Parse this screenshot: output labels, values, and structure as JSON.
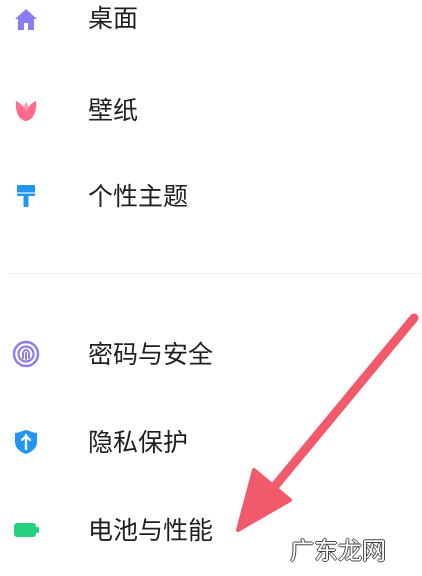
{
  "settings": {
    "items": [
      {
        "label": "桌面",
        "icon": "home-icon",
        "color": "#8b7cf6"
      },
      {
        "label": "壁纸",
        "icon": "tulip-icon",
        "color": "#ff6b8a"
      },
      {
        "label": "个性主题",
        "icon": "paint-brush-icon",
        "color": "#2196f3"
      },
      {
        "label": "密码与安全",
        "icon": "fingerprint-icon",
        "color": "#8a7ef0"
      },
      {
        "label": "隐私保护",
        "icon": "privacy-shield-icon",
        "color": "#2196f3"
      },
      {
        "label": "电池与性能",
        "icon": "battery-icon",
        "color": "#26d07c"
      }
    ]
  },
  "annotation": {
    "arrow_color": "#f05a6b"
  },
  "watermark": "广东龙网"
}
